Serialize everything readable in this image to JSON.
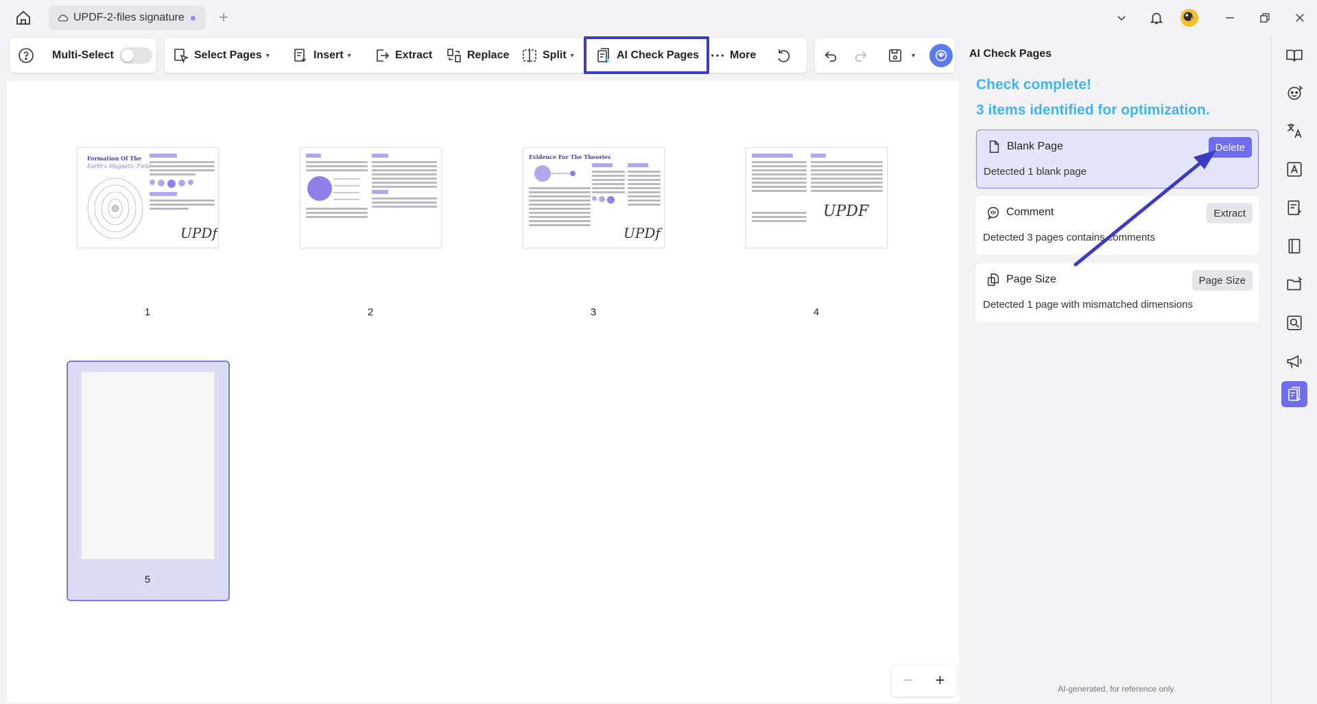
{
  "titlebar": {
    "tab_title": "UPDF-2-files signature",
    "new_tab": "+"
  },
  "toolbar": {
    "multi_select": "Multi-Select",
    "select_pages": "Select Pages",
    "insert": "Insert",
    "extract": "Extract",
    "replace": "Replace",
    "split": "Split",
    "ai_check_pages": "AI Check Pages",
    "more": "More"
  },
  "pages": [
    {
      "number": "1",
      "sig": "UPDf",
      "heading": "Formation Of The",
      "subheading": "Earth's Magnetic Field"
    },
    {
      "number": "2",
      "sig": "",
      "heading": "",
      "subheading": ""
    },
    {
      "number": "3",
      "sig": "UPDf",
      "heading": "Evidence For The Theories",
      "subheading": ""
    },
    {
      "number": "4",
      "sig": "UPDF",
      "heading": "",
      "subheading": ""
    },
    {
      "number": "5",
      "sig": "",
      "heading": "",
      "subheading": ""
    }
  ],
  "zoom": {
    "minus": "−",
    "plus": "+"
  },
  "panel": {
    "title": "AI Check Pages",
    "complete_line1": "Check complete!",
    "complete_line2": "3 items identified for optimization.",
    "cards": [
      {
        "title": "Blank Page",
        "desc": "Detected 1 blank page",
        "button": "Delete"
      },
      {
        "title": "Comment",
        "desc": "Detected 3 pages contains comments",
        "button": "Extract"
      },
      {
        "title": "Page Size",
        "desc": "Detected 1 page with mismatched dimensions",
        "button": "Page Size"
      }
    ],
    "footnote": "AI-generated, for reference only."
  },
  "colors": {
    "accent": "#6d6ded",
    "highlight_box": "#3b3bc4",
    "success_text": "#3fb4ee",
    "arrow": "#3b3bc4"
  }
}
